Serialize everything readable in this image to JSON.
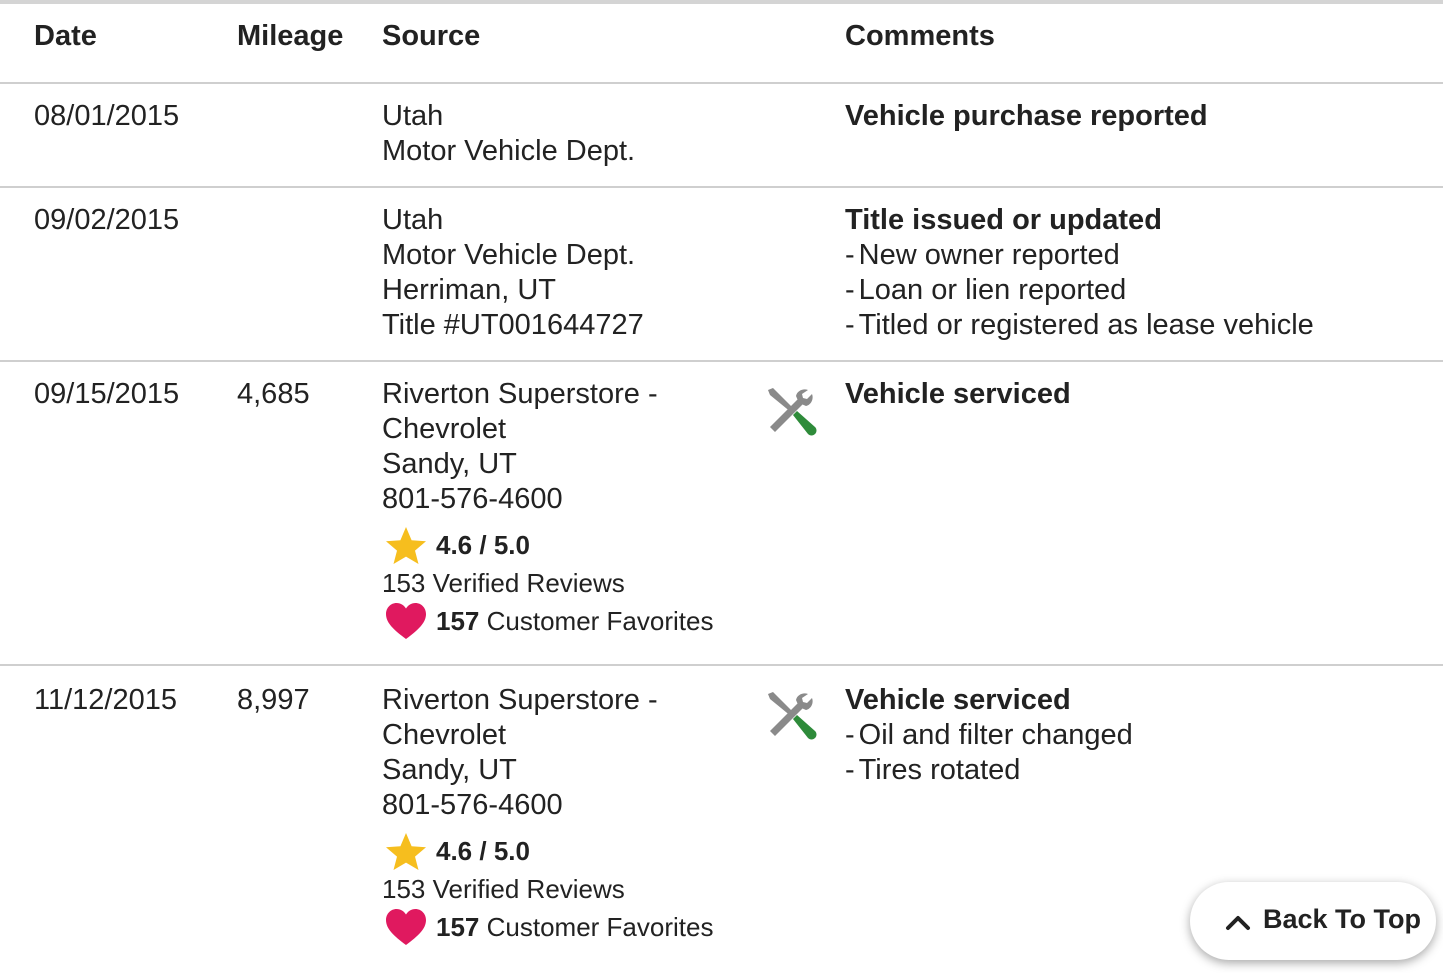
{
  "table": {
    "headers": {
      "date": "Date",
      "mileage": "Mileage",
      "source": "Source",
      "comments": "Comments"
    },
    "rows": [
      {
        "date": "08/01/2015",
        "mileage": "",
        "source": [
          "Utah",
          "Motor Vehicle Dept."
        ],
        "icon": "",
        "comment_title": "Vehicle purchase reported",
        "comment_items": []
      },
      {
        "date": "09/02/2015",
        "mileage": "",
        "source": [
          "Utah",
          "Motor Vehicle Dept.",
          "Herriman, UT",
          "Title #UT001644727"
        ],
        "icon": "",
        "comment_title": "Title issued or updated",
        "comment_items": [
          "New owner reported",
          "Loan or lien reported",
          "Titled or registered as lease vehicle"
        ]
      },
      {
        "date": "09/15/2015",
        "mileage": "4,685",
        "source": [
          "Riverton Superstore -",
          "Chevrolet",
          "Sandy, UT",
          "801-576-4600"
        ],
        "icon": "wrench-screwdriver-icon",
        "rating": "4.6 / 5.0",
        "reviews": "153 Verified Reviews",
        "favorites_count": "157",
        "favorites_label": "Customer Favorites",
        "comment_title": "Vehicle serviced",
        "comment_items": []
      },
      {
        "date": "11/12/2015",
        "mileage": "8,997",
        "source": [
          "Riverton Superstore -",
          "Chevrolet",
          "Sandy, UT",
          "801-576-4600"
        ],
        "icon": "wrench-screwdriver-icon",
        "rating": "4.6 / 5.0",
        "reviews": "153 Verified Reviews",
        "favorites_count": "157",
        "favorites_label": "Customer Favorites",
        "comment_title": "Vehicle serviced",
        "comment_items": [
          "Oil and filter changed",
          "Tires rotated"
        ]
      }
    ]
  },
  "back_to_top": {
    "label": "Back To Top",
    "icon": "chevron-up-icon"
  },
  "colors": {
    "star": "#F6BE1E",
    "heart": "#E0195F",
    "screwdriver_handle": "#2E8B3A",
    "tool_gray": "#8A8A8A",
    "divider": "#CFCFCF"
  }
}
